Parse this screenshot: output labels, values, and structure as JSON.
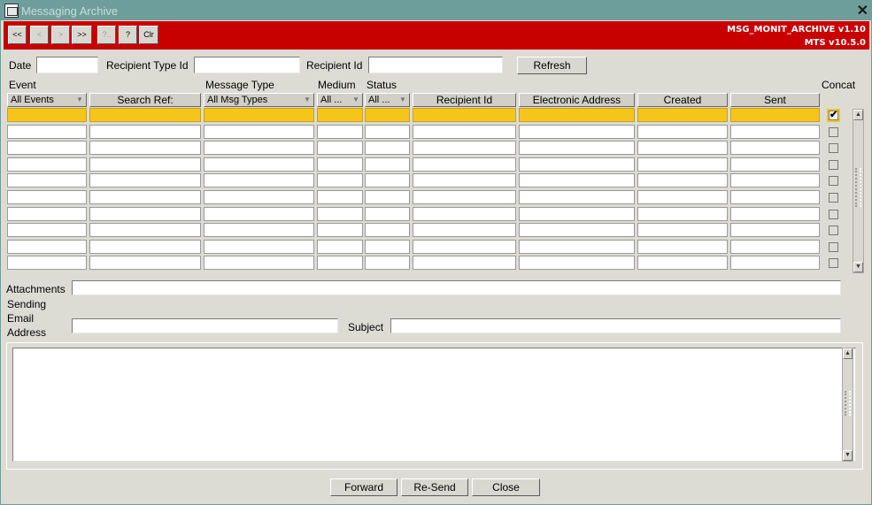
{
  "window": {
    "title": "Messaging Archive",
    "close_glyph": "✕"
  },
  "toolbar": {
    "buttons": [
      "<<",
      "<",
      ">",
      ">>",
      "?..",
      "?",
      "Clr"
    ],
    "version_line1": "MSG_MONIT_ARCHIVE v1.10",
    "version_line2": "MTS v10.5.0",
    "background": "#c80000"
  },
  "filters": {
    "date_label": "Date",
    "date_value": "",
    "recipient_type_label": "Recipient Type Id",
    "recipient_type_value": "",
    "recipient_id_label": "Recipient Id",
    "recipient_id_value": "",
    "refresh_button": "Refresh"
  },
  "grid": {
    "group_labels": {
      "event": "Event",
      "message_type": "Message Type",
      "medium": "Medium",
      "status": "Status",
      "concat": "Concat"
    },
    "headers": {
      "event": "All Events",
      "search_ref": "Search Ref:",
      "message_type": "All Msg Types",
      "medium": "All ...",
      "status": "All ...",
      "recipient_id": "Recipient Id",
      "electronic_address": "Electronic Address",
      "created": "Created",
      "sent": "Sent"
    },
    "row_count": 10,
    "selected_row": 0,
    "concat_checked": [
      true,
      false,
      false,
      false,
      false,
      false,
      false,
      false,
      false,
      false
    ],
    "selection_color": "#f6c51c"
  },
  "details": {
    "attachments_label": "Attachments",
    "attachments_value": "",
    "sending_label_1": "Sending",
    "sending_label_2": "Email",
    "sending_label_3": "Address",
    "sending_value": "",
    "subject_label": "Subject",
    "subject_value": "",
    "body_value": ""
  },
  "actions": {
    "forward": "Forward",
    "resend": "Re-Send",
    "close": "Close"
  },
  "icons": {
    "checkmark": "✔",
    "arrow_down": "▼",
    "arrow_up": "▲"
  }
}
